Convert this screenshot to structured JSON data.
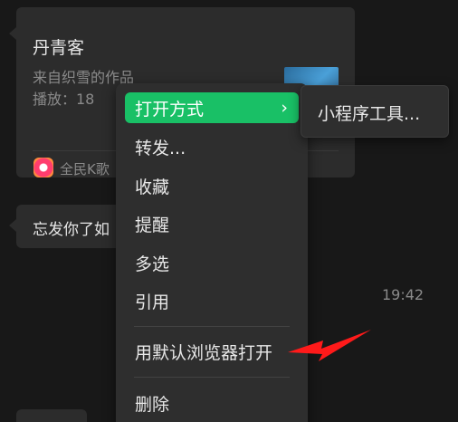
{
  "chat": {
    "music_card": {
      "title": "丹青客",
      "subtitle": "来自织雪的作品",
      "plays": "播放：18",
      "app_name": "全民K歌"
    },
    "text_message": "忘发你了如",
    "timestamp": "19:42"
  },
  "context_menu": {
    "items": [
      {
        "label": "打开方式",
        "has_submenu": true,
        "active": true
      },
      {
        "label": "转发..."
      },
      {
        "label": "收藏"
      },
      {
        "label": "提醒"
      },
      {
        "label": "多选"
      },
      {
        "label": "引用"
      },
      {
        "label": "用默认浏览器打开"
      },
      {
        "label": "删除"
      }
    ],
    "submenu_arrow": "›",
    "submenu": {
      "items": [
        {
          "label": "小程序工具..."
        }
      ]
    }
  },
  "colors": {
    "background": "#181818",
    "bubble": "#2c2c2c",
    "menu": "#2e2e2e",
    "accent_green": "#19c066",
    "annotation_red": "#ff1a1a"
  },
  "icons": {
    "app_icon": "kge-app-icon",
    "submenu_arrow": "chevron-right-icon",
    "annotation": "red-arrow-icon"
  }
}
